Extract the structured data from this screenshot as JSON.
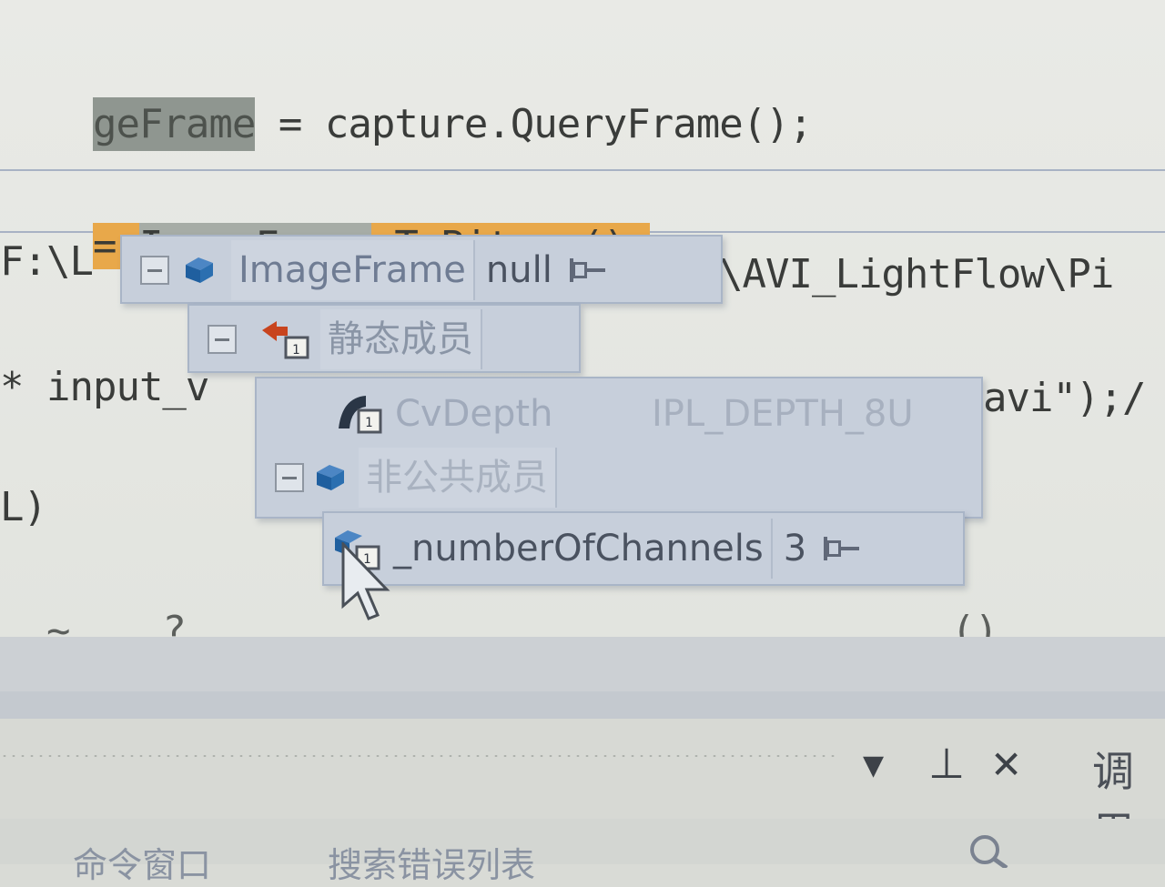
{
  "editor": {
    "lines": [
      {
        "pre_highlight": "geFrame",
        "rest": " = capture.QueryFrame();"
      },
      {
        "eq": "= ",
        "var": "ImageFrame",
        "method": ".ToBitmap();"
      },
      {
        "text": "F:\\L"
      },
      {
        "text_right": "\\AVI_LightFlow\\Pi"
      },
      {
        "text": "* input_v"
      },
      {
        "text_right": "avi\");/"
      },
      {
        "text": "L)"
      },
      {
        "text": "  ~    ?  .            .         .       ()"
      }
    ]
  },
  "datatip": {
    "root": {
      "name": "ImageFrame",
      "value": "null"
    },
    "static_group": {
      "label": "静态成员"
    },
    "static_items": [
      {
        "name": "CvDepth",
        "value": "IPL_DEPTH_8U"
      }
    ],
    "nonpublic_group": {
      "label": "非公共成员"
    },
    "nonpublic_items": [
      {
        "name": "_numberOfChannels",
        "value": "3"
      }
    ]
  },
  "bottom_panel": {
    "dropdown_glyph": "▼",
    "pin_glyph": "⊥",
    "close_glyph": "✕",
    "right_title": "调用",
    "tabs": [
      "命令窗口",
      "搜索错误列表"
    ]
  },
  "colors": {
    "highlight_orange": "#e8a84a",
    "highlight_gray": "#8f9690",
    "tooltip_bg": "#c7cfdb",
    "icon_blue": "#2f6fb0"
  }
}
